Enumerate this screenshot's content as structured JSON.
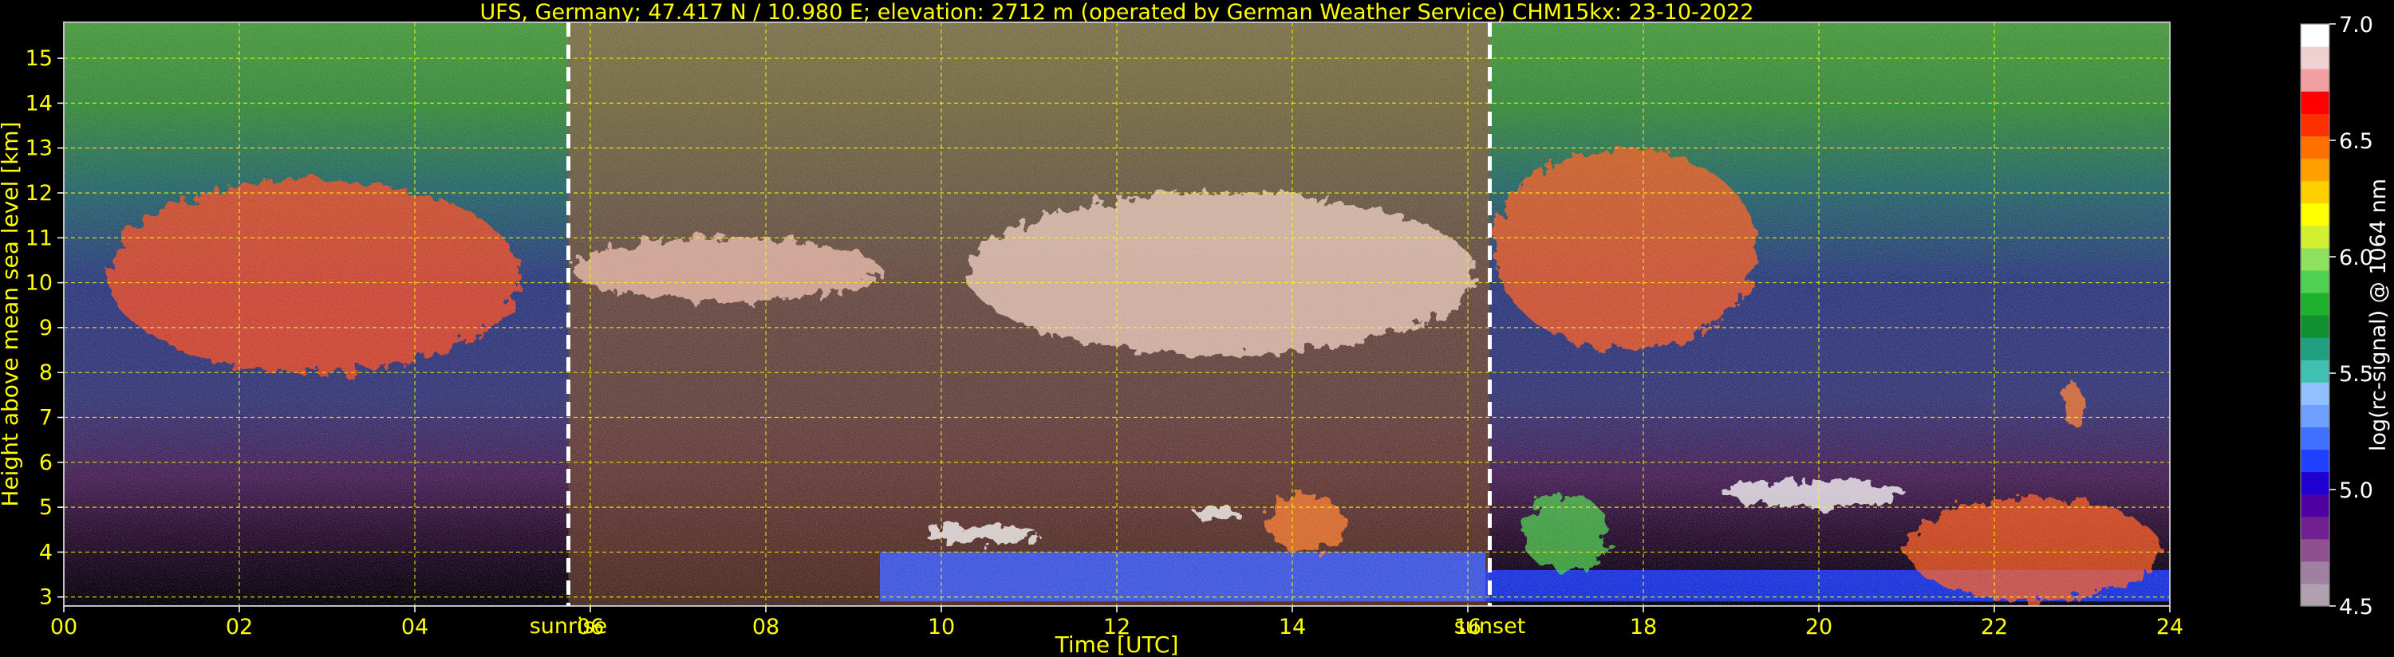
{
  "chart_data": {
    "type": "heatmap",
    "title": "UFS, Germany; 47.417 N / 10.980 E; elevation: 2712 m  (operated by German Weather Service)    CHM15kx: 23-10-2022",
    "xlabel": "Time [UTC]",
    "ylabel": "Height above mean sea level [km]",
    "xlim": [
      0,
      24
    ],
    "ylim": [
      2.8,
      15.8
    ],
    "x_ticks": [
      "00",
      "02",
      "04",
      "06",
      "08",
      "10",
      "12",
      "14",
      "16",
      "18",
      "20",
      "22",
      "24"
    ],
    "x_tick_values": [
      0,
      2,
      4,
      6,
      8,
      10,
      12,
      14,
      16,
      18,
      20,
      22,
      24
    ],
    "y_ticks": [
      "3",
      "4",
      "5",
      "6",
      "7",
      "8",
      "9",
      "10",
      "11",
      "12",
      "13",
      "14",
      "15"
    ],
    "y_tick_values": [
      3,
      4,
      5,
      6,
      7,
      8,
      9,
      10,
      11,
      12,
      13,
      14,
      15
    ],
    "grid": true,
    "markers": [
      {
        "label": "sunrise",
        "x": 5.75
      },
      {
        "label": "sunset",
        "x": 16.25
      }
    ],
    "colorbar": {
      "label": "log(rc-signal) @ 1064 nm",
      "ticks": [
        "4.5",
        "5.0",
        "5.5",
        "6.0",
        "6.5",
        "7.0"
      ],
      "tick_values": [
        4.5,
        5.0,
        5.5,
        6.0,
        6.5,
        7.0
      ],
      "range": [
        4.5,
        7.0
      ],
      "colors": [
        "#b0a0b0",
        "#a080a0",
        "#905090",
        "#702090",
        "#5000a0",
        "#2000d0",
        "#2040ff",
        "#4070ff",
        "#70a0ff",
        "#90c0ff",
        "#40c0b0",
        "#20a080",
        "#109030",
        "#20b030",
        "#50d050",
        "#90e060",
        "#d0f030",
        "#ffff00",
        "#ffd000",
        "#ffa000",
        "#ff7000",
        "#ff3000",
        "#ff0000",
        "#f0a0a0",
        "#f0d0d0",
        "#ffffff"
      ]
    },
    "cloud_layers": [
      {
        "t0": 0.5,
        "t1": 5.2,
        "h0": 8.0,
        "h1": 12.3,
        "color": "#ff5020"
      },
      {
        "t0": 5.8,
        "t1": 9.3,
        "h0": 9.6,
        "h1": 11.0,
        "color": "#f0c0b0"
      },
      {
        "t0": 10.3,
        "t1": 16.1,
        "h0": 8.4,
        "h1": 12.0,
        "color": "#f0d0c0"
      },
      {
        "t0": 16.3,
        "t1": 19.3,
        "h0": 8.5,
        "h1": 13.0,
        "color": "#ff6020"
      },
      {
        "t0": 9.8,
        "t1": 11.1,
        "h0": 4.2,
        "h1": 4.6,
        "color": "#ffffff"
      },
      {
        "t0": 12.9,
        "t1": 13.4,
        "h0": 4.7,
        "h1": 5.0,
        "color": "#ffffff"
      },
      {
        "t0": 13.7,
        "t1": 14.6,
        "h0": 4.0,
        "h1": 5.3,
        "color": "#ff8030"
      },
      {
        "t0": 16.6,
        "t1": 17.6,
        "h0": 3.6,
        "h1": 5.3,
        "color": "#50d050"
      },
      {
        "t0": 18.9,
        "t1": 21.0,
        "h0": 5.0,
        "h1": 5.6,
        "color": "#ffffff"
      },
      {
        "t0": 21.0,
        "t1": 23.9,
        "h0": 2.9,
        "h1": 5.2,
        "color": "#ff6020"
      },
      {
        "t0": 22.8,
        "t1": 23.0,
        "h0": 6.8,
        "h1": 7.8,
        "color": "#ff8030"
      }
    ],
    "boundary_layer": [
      {
        "t0": 9.3,
        "t1": 16.2,
        "h0": 2.9,
        "h1": 4.0,
        "color": "#4060ff"
      },
      {
        "t0": 16.2,
        "t1": 24,
        "h0": 2.9,
        "h1": 3.6,
        "color": "#2040ff"
      }
    ]
  }
}
